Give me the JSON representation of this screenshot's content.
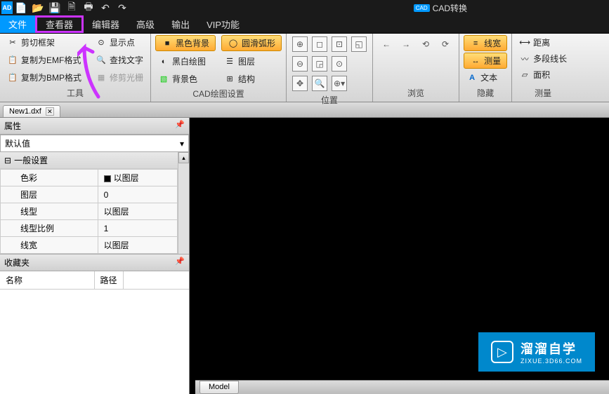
{
  "quick_access": {
    "logo": "AD",
    "cad_badge": "CAD",
    "cad_text": "CAD转换"
  },
  "menu": {
    "items": [
      "文件",
      "查看器",
      "编辑器",
      "高级",
      "输出",
      "VIP功能"
    ]
  },
  "ribbon": {
    "groups": [
      {
        "label": "工具",
        "buttons": [
          {
            "label": "剪切框架"
          },
          {
            "label": "复制为EMF格式"
          },
          {
            "label": "复制为BMP格式"
          }
        ],
        "buttons2": [
          {
            "label": "显示点"
          },
          {
            "label": "查找文字"
          },
          {
            "label": "修剪光栅",
            "disabled": true
          }
        ]
      },
      {
        "label": "CAD绘图设置",
        "buttons": [
          {
            "label": "黑色背景",
            "pill": true
          },
          {
            "label": "黑白绘图"
          },
          {
            "label": "背景色"
          }
        ],
        "buttons2": [
          {
            "label": "圆滑弧形",
            "pill": true
          },
          {
            "label": "图层"
          },
          {
            "label": "结构"
          }
        ]
      },
      {
        "label": "位置"
      },
      {
        "label": "浏览"
      },
      {
        "label": "隐藏",
        "buttons": [
          {
            "label": "线宽",
            "orange": true
          },
          {
            "label": "测量",
            "orange": true
          },
          {
            "label": "文本"
          }
        ]
      },
      {
        "label": "测量",
        "buttons": [
          {
            "label": "距离"
          },
          {
            "label": "多段线长"
          },
          {
            "label": "面积"
          }
        ]
      }
    ]
  },
  "doc_tab": {
    "name": "New1.dxf"
  },
  "props": {
    "title": "属性",
    "default": "默认值",
    "section": "一般设置",
    "rows": [
      {
        "name": "色彩",
        "value": "以图层",
        "swatch": true
      },
      {
        "name": "图层",
        "value": "0"
      },
      {
        "name": "线型",
        "value": "以图层"
      },
      {
        "name": "线型比例",
        "value": "1"
      },
      {
        "name": "线宽",
        "value": "以图层"
      }
    ]
  },
  "favorites": {
    "title": "收藏夹",
    "cols": [
      "名称",
      "路径"
    ]
  },
  "model_tab": "Model",
  "watermark": {
    "title": "溜溜自学",
    "sub": "ZIXUE.3D66.COM"
  }
}
